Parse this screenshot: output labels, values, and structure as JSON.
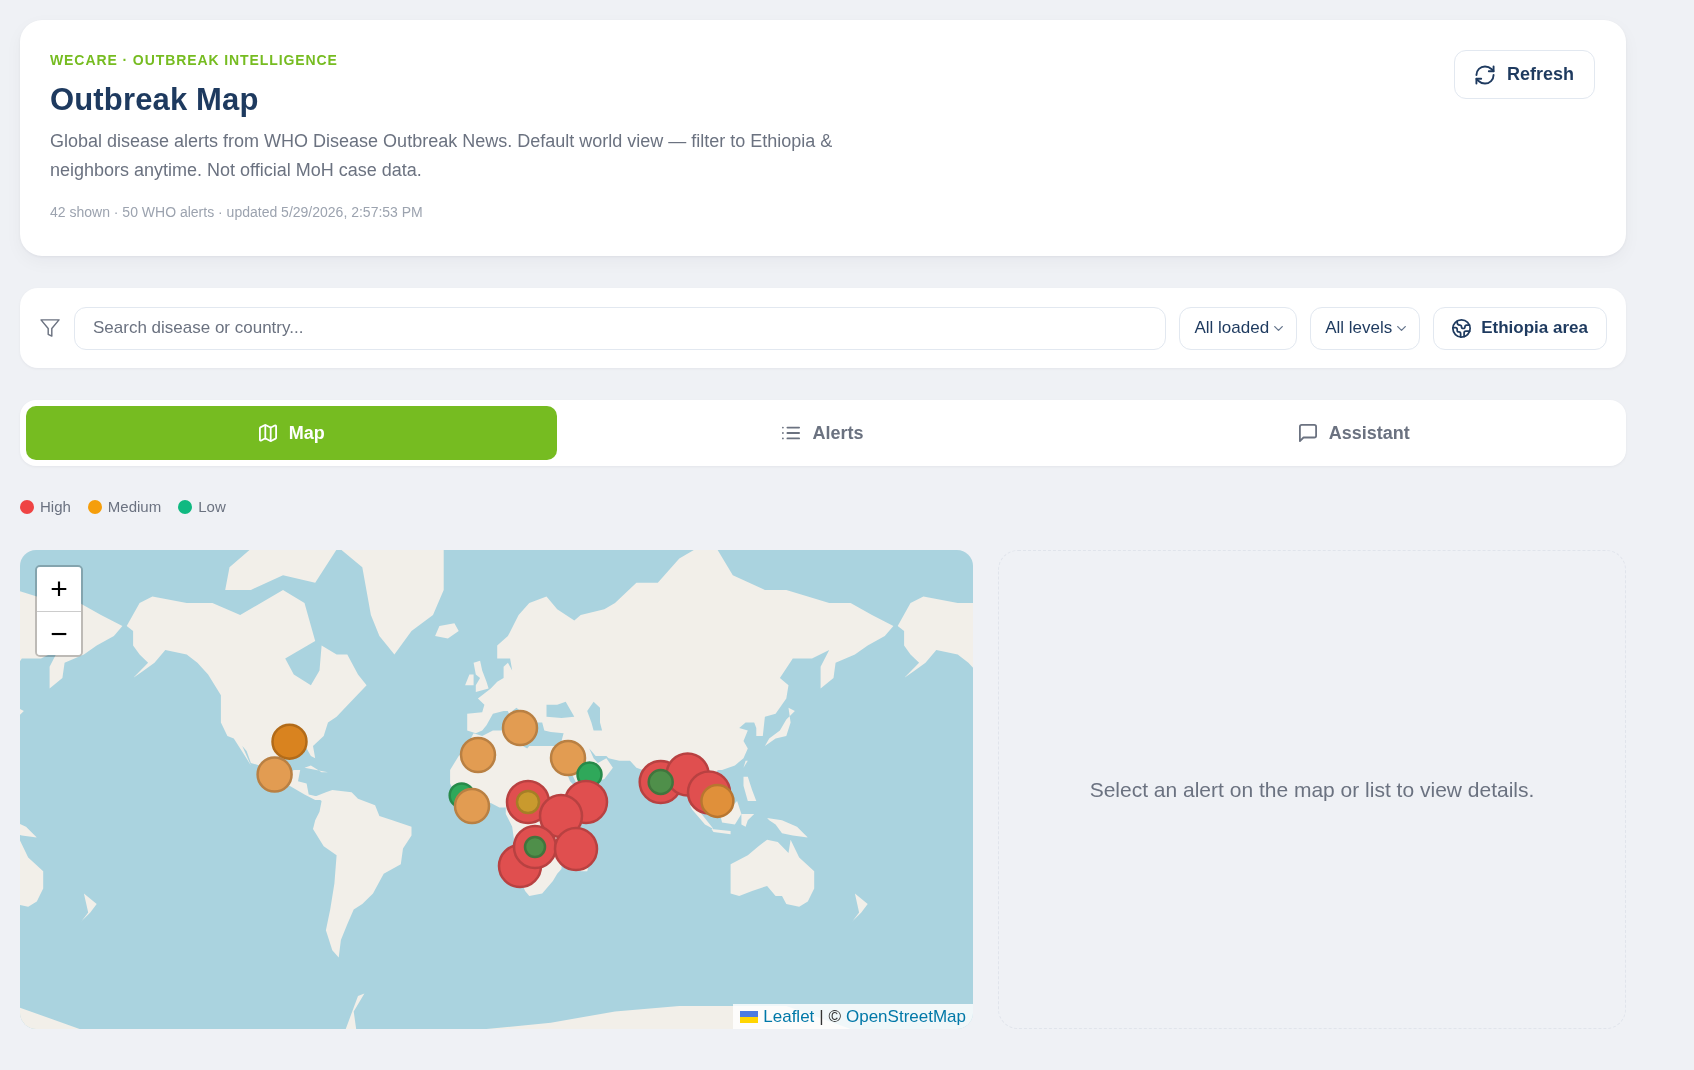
{
  "header": {
    "eyebrow": "WECARE · OUTBREAK INTELLIGENCE",
    "title": "Outbreak Map",
    "description": "Global disease alerts from WHO Disease Outbreak News. Default world view — filter to Ethiopia & neighbors anytime. Not official MoH case data.",
    "meta": "42 shown · 50 WHO alerts · updated 5/29/2026, 2:57:53 PM",
    "refresh_button": "Refresh"
  },
  "filters": {
    "search": {
      "placeholder": "Search disease or country..."
    },
    "options": [
      {
        "kind": "dropdown",
        "label": "All loaded"
      },
      {
        "kind": "dropdown",
        "label": "All levels"
      },
      {
        "kind": "toggle",
        "label": "Ethiopia area"
      }
    ]
  },
  "tabs": [
    {
      "label": "Map",
      "selected": true
    },
    {
      "label": "Alerts",
      "selected": false
    },
    {
      "label": "Assistant",
      "selected": false
    }
  ],
  "legend": [
    {
      "label": "High",
      "color": "#ef4444"
    },
    {
      "label": "Medium",
      "color": "#f59e0b"
    },
    {
      "label": "Low",
      "color": "#10b981"
    }
  ],
  "map": {
    "zoom_in": "+",
    "zoom_out": "−",
    "markers": [
      {
        "color": "#d9831f"
      },
      {
        "color": "#e29c52"
      },
      {
        "color": "#e29c52"
      },
      {
        "color": "#e29c52"
      },
      {
        "color": "#e29c52"
      },
      {
        "color": "#2fa85a"
      },
      {
        "color": "#2fa85a"
      },
      {
        "color": "#e29c52"
      },
      {
        "color": "#e04f4f"
      },
      {
        "color": "#e04f4f"
      },
      {
        "color": "#e04f4f"
      },
      {
        "color": "#e04f4f"
      },
      {
        "color": "#e04f4f"
      },
      {
        "color": "#e04f4f"
      },
      {
        "color": "#c99a2e"
      },
      {
        "color": "#4f8f4a"
      },
      {
        "color": "#e04f4f"
      },
      {
        "color": "#e04f4f"
      },
      {
        "color": "#e04f4f"
      },
      {
        "color": "#e0903a"
      },
      {
        "color": "#4f8f4a"
      }
    ],
    "attribution": {
      "leaflet_link": "Leaflet",
      "separator": "| ©",
      "osm_link": "OpenStreetMap"
    }
  },
  "detail_panel": {
    "empty_message": "Select an alert on the map or list to view details."
  }
}
